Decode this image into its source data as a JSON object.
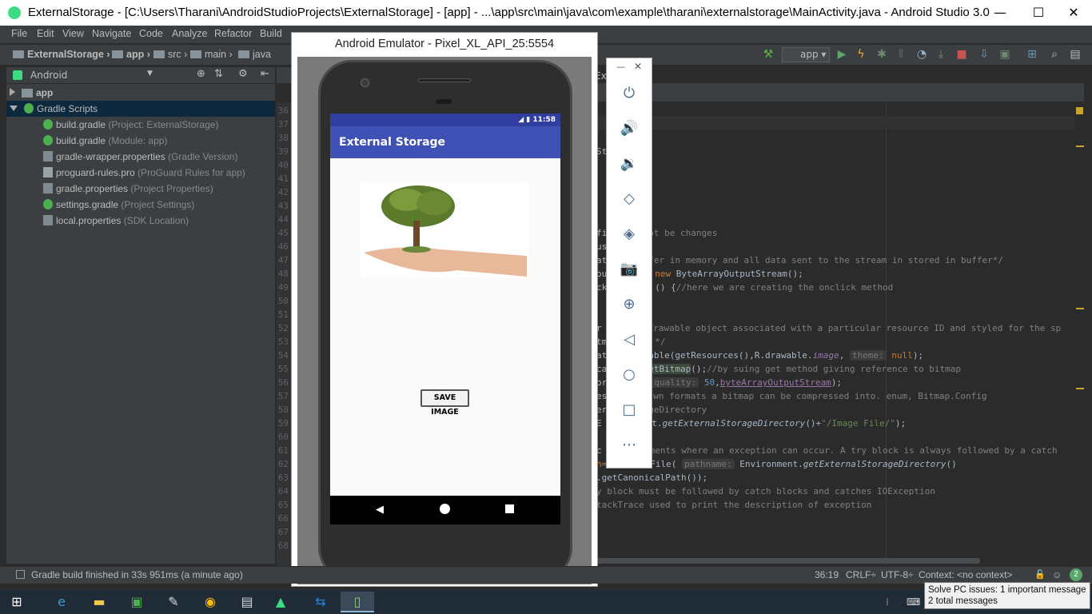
{
  "window": {
    "title": "ExternalStorage - [C:\\Users\\Tharani\\AndroidStudioProjects\\ExternalStorage] - [app] - ...\\app\\src\\main\\java\\com\\example\\tharani\\externalstorage\\MainActivity.java - Android Studio 3.0",
    "minimize": "—",
    "maximize": "☐",
    "close": "✕"
  },
  "menu": [
    "File",
    "Edit",
    "View",
    "Navigate",
    "Code",
    "Analyze",
    "Refactor",
    "Build"
  ],
  "breadcrumb": [
    "ExternalStorage",
    "app",
    "src",
    "main",
    "java"
  ],
  "toolbar": {
    "run_config": "app"
  },
  "project_panel": {
    "view": "Android",
    "tree": [
      {
        "label": "app",
        "hint": ""
      },
      {
        "label": "Gradle Scripts",
        "hint": ""
      },
      {
        "label": "build.gradle",
        "hint": "(Project: ExternalStorage)"
      },
      {
        "label": "build.gradle",
        "hint": "(Module: app)"
      },
      {
        "label": "gradle-wrapper.properties",
        "hint": "(Gradle Version)"
      },
      {
        "label": "proguard-rules.pro",
        "hint": "(ProGuard Rules for app)"
      },
      {
        "label": "gradle.properties",
        "hint": "(Project Properties)"
      },
      {
        "label": "settings.gradle",
        "hint": "(Project Settings)"
      },
      {
        "label": "local.properties",
        "hint": "(SDK Location)"
      }
    ]
  },
  "editor": {
    "line_numbers": [
      "36",
      "37",
      "38",
      "39",
      "40",
      "41",
      "42",
      "43",
      "44",
      "45",
      "46",
      "47",
      "48",
      "49",
      "50",
      "51",
      "52",
      "53",
      "54",
      "55",
      "56",
      "57",
      "58",
      "59",
      "60",
      "61",
      "62",
      "63",
      "64",
      "65",
      "66",
      "67",
      "68"
    ],
    "code": {
      "l1": "St",
      "l2": "fi",
      "l2b": "ot be changes",
      "l3": "us",
      "l4a": "at",
      "l4b": "fer in memory and all data sent to the stream in stored in buffer*/",
      "l5a": "ou",
      "l5b": "new",
      "l5c": " ByteArrayOutputStream();",
      "l6a": "ck",
      "l6b": "() {",
      "l6c": "//here we are creating the onclick method",
      "l7a": "r",
      "l7b": "drawable object associated with a particular resource ID and styled for the sp",
      "l8": "tm",
      "l8b": "*/",
      "l9a": "at",
      "l9b": "able(getResources(),R.drawable.",
      "l9c": "image",
      "l9d": ", ",
      "l9e": "theme:",
      "l9f": " null",
      "l9g": ");",
      "l10a": "ca",
      "l10b": "etBitmap",
      "l10c": "();",
      "l10d": "//by suing get method giving reference to bitmap",
      "l11a": "or",
      "l11b": "quality:",
      "l11c": " 50",
      "l11d": ",",
      "l11e": "byteArrayOutputStream",
      "l11f": ");",
      "l12a": "es",
      "l12b": "wn formats a bitmap can be compressed into. enum, Bitmap.Config",
      "l13a": "er",
      "l13b": "geDirectory",
      "l14a": "E",
      "l14b": "nt.",
      "l14c": "getExternalStorageDirectory",
      "l14d": "()+",
      "l14e": "\"/Image File/\"",
      "l14f": ");",
      "l15a": "c",
      "l15b": "ments where an exception can occur. A try block is always followed by a catch",
      "l16a": "h=",
      "l16b": "File(",
      "l16c": "pathname:",
      "l16d": " Environment.",
      "l16e": "getExternalStorageDirectory",
      "l16f": "()",
      "l17": ".getCanonicalPath());",
      "l18a": "y",
      "l18b": " block must be followed by catch blocks and catches IOException",
      "l19": "tackTrace used to print the description of exception",
      "tab_fragment": "Ex"
    }
  },
  "status": {
    "message": "Gradle build finished in 33s 951ms (a minute ago)",
    "position": "36:19",
    "line_sep": "CRLF÷",
    "encoding": "UTF-8÷",
    "context": "Context: <no context>",
    "badge": "2"
  },
  "emulator": {
    "title": "Android Emulator - Pixel_XL_API_25:5554",
    "time": "11:58",
    "app_title": "External Storage",
    "button": "SAVE IMAGE"
  },
  "emulator_controls": [
    "power-icon",
    "volume-up-icon",
    "volume-down-icon",
    "rotate-left-icon",
    "rotate-right-icon",
    "camera-icon",
    "zoom-icon",
    "back-icon",
    "home-icon",
    "overview-icon",
    "more-icon"
  ],
  "notification": {
    "line1": "Solve PC issues: 1 important message",
    "line2": "2 total messages"
  },
  "colors": {
    "ide_bg": "#2b2b2b",
    "panel_bg": "#3c3f41",
    "app_bar": "#3f51b5",
    "status_bar": "#303f9f",
    "selection": "#0d293e"
  }
}
